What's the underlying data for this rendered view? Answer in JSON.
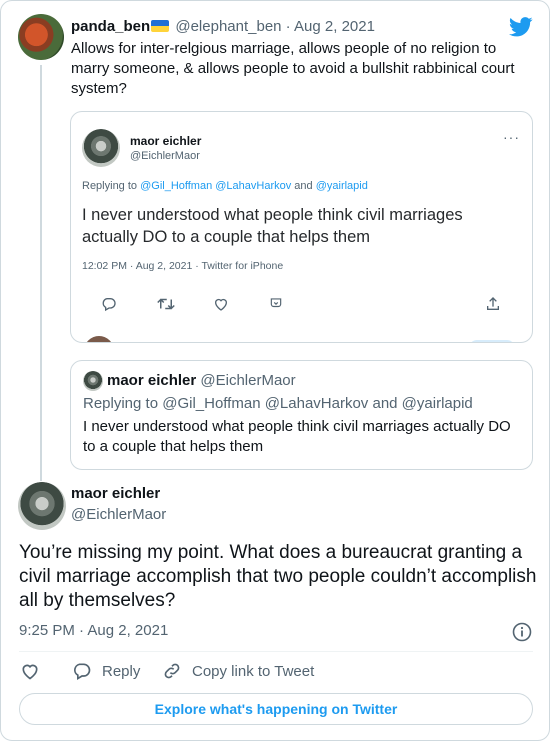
{
  "colors": {
    "accent": "#1d9bf0",
    "text": "#0f1419",
    "muted": "#536471",
    "border": "#cfd9de"
  },
  "reply_tweet": {
    "name": "panda_ben",
    "flag_icon": "ukraine-flag-icon",
    "handle": "@elephant_ben",
    "separator": " · ",
    "date": "Aug 2, 2021",
    "text": "Allows for inter-relgious marriage, allows people of no religion to marry someone, & allows people to avoid a bullshit rabbinical court system?"
  },
  "embedded_screenshot": {
    "name": "maor eichler",
    "handle": "@EichlerMaor",
    "more": "···",
    "replying_prefix": "Replying to ",
    "replying_to_1": "@Gil_Hoffman",
    "replying_to_2": "@LahavHarkov",
    "replying_and": " and ",
    "replying_to_3": "@yairlapid",
    "text": "I never understood what people think civil marriages actually DO to a couple that helps them",
    "meta": "12:02 PM · Aug 2, 2021 · Twitter for iPhone"
  },
  "quote_tweet": {
    "name": "maor eichler",
    "handle": "@EichlerMaor",
    "replying": "Replying to @Gil_Hoffman @LahavHarkov and @yairlapid",
    "text": "I never understood what people think civil marriages actually DO to a couple that helps them"
  },
  "main_tweet": {
    "name": "maor eichler",
    "handle": "@EichlerMaor",
    "text": "You’re missing my point. What does a bureaucrat granting a civil marriage accomplish that two people couldn’t accomplish all by themselves?",
    "time": "9:25 PM",
    "separator": " · ",
    "date": "Aug 2, 2021"
  },
  "actions": {
    "like_icon": "heart-icon",
    "reply_label": "Reply",
    "copy_link_label": "Copy link to Tweet"
  },
  "explore_label": "Explore what's happening on Twitter"
}
